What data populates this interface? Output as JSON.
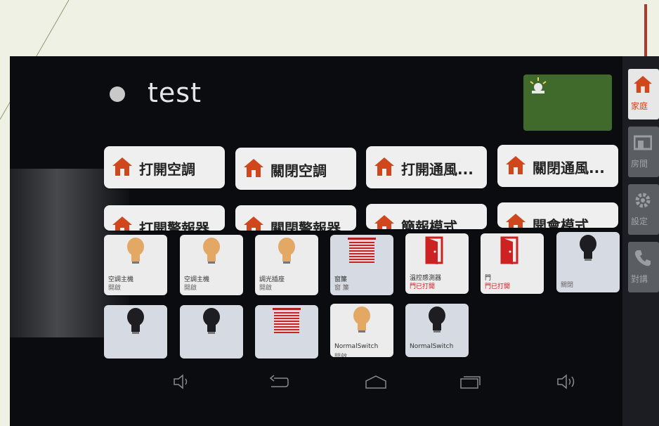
{
  "room": {
    "title": "test"
  },
  "sidebar": {
    "items": [
      {
        "label": "家庭",
        "icon": "home-icon",
        "active": true
      },
      {
        "label": "房間",
        "icon": "room-icon"
      },
      {
        "label": "設定",
        "icon": "settings-icon"
      },
      {
        "label": "對講",
        "icon": "phone-icon"
      }
    ]
  },
  "scenes": [
    {
      "label": "打開空調"
    },
    {
      "label": "關閉空調"
    },
    {
      "label": "打開通風..."
    },
    {
      "label": "關閉通風..."
    },
    {
      "label": "打開警報器"
    },
    {
      "label": "關閉警報器"
    },
    {
      "label": "簡報模式"
    },
    {
      "label": "開會模式"
    }
  ],
  "devices": [
    {
      "name": "空調主機",
      "state": "開啟",
      "icon": "bulb-on-icon"
    },
    {
      "name": "空調主機",
      "state": "開啟",
      "icon": "bulb-on-icon"
    },
    {
      "name": "調光插座",
      "state": "開啟",
      "icon": "bulb-on-icon"
    },
    {
      "name": "窗簾",
      "state": "窗 簾",
      "icon": "curtain-icon"
    },
    {
      "name": "溫控感測器",
      "state": "門已打開",
      "icon": "door-icon"
    },
    {
      "name": "門",
      "state": "門已打開",
      "icon": "door-icon"
    },
    {
      "name": "",
      "state": "關閉",
      "icon": "bulb-off-icon"
    },
    {
      "name": "",
      "state": "",
      "icon": "bulb-off-icon"
    },
    {
      "name": "",
      "state": "",
      "icon": "bulb-off-icon"
    },
    {
      "name": "",
      "state": "",
      "icon": "curtain-icon"
    },
    {
      "name": "NormalSwitch",
      "state": "開啟",
      "icon": "bulb-on-icon"
    },
    {
      "name": "NormalSwitch",
      "state": "",
      "icon": "bulb-off-icon"
    }
  ],
  "colors": {
    "accent": "#d0461d",
    "alarm_bg": "#3f6a2c",
    "door_red": "#c22222",
    "bulb_on": "#e2a864"
  }
}
